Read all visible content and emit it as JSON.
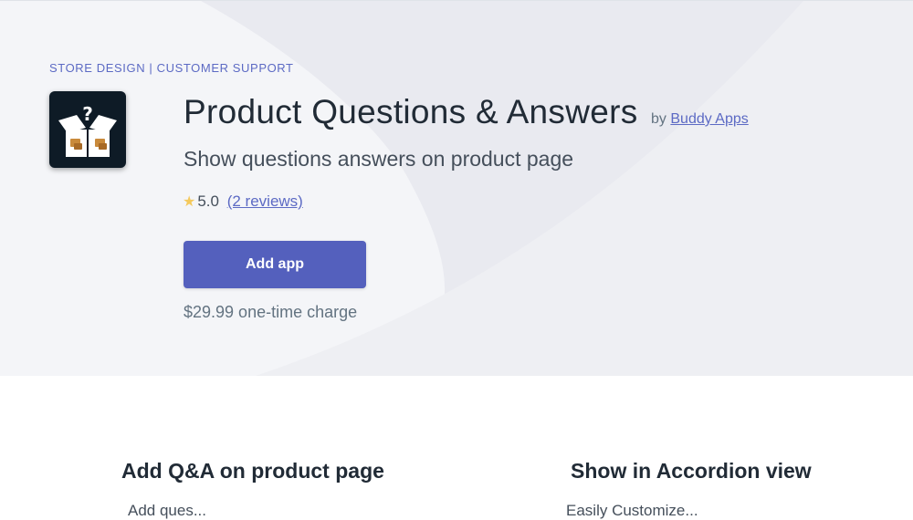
{
  "hero": {
    "categories": [
      "STORE DESIGN",
      "CUSTOMER SUPPORT"
    ],
    "category_separator": "|",
    "app_icon": "open-box-question-icon",
    "title": "Product Questions & Answers",
    "by_label": "by",
    "developer": "Buddy Apps",
    "subtitle": "Show questions answers on product page",
    "rating_icon": "star-icon",
    "rating": "5.0",
    "reviews_label": "(2 reviews)",
    "add_button_label": "Add app",
    "price": "$29.99 one-time charge"
  },
  "features": [
    {
      "title": "Add Q&A on product page",
      "text": "Add ques..."
    },
    {
      "title": "Show in Accordion view",
      "text": "Easily Customize..."
    }
  ],
  "colors": {
    "accent": "#5c6ac4",
    "button": "#5460bd",
    "hero_bg": "#f4f5f8",
    "star": "#f4c95d",
    "icon_bg": "#0e1b26"
  }
}
